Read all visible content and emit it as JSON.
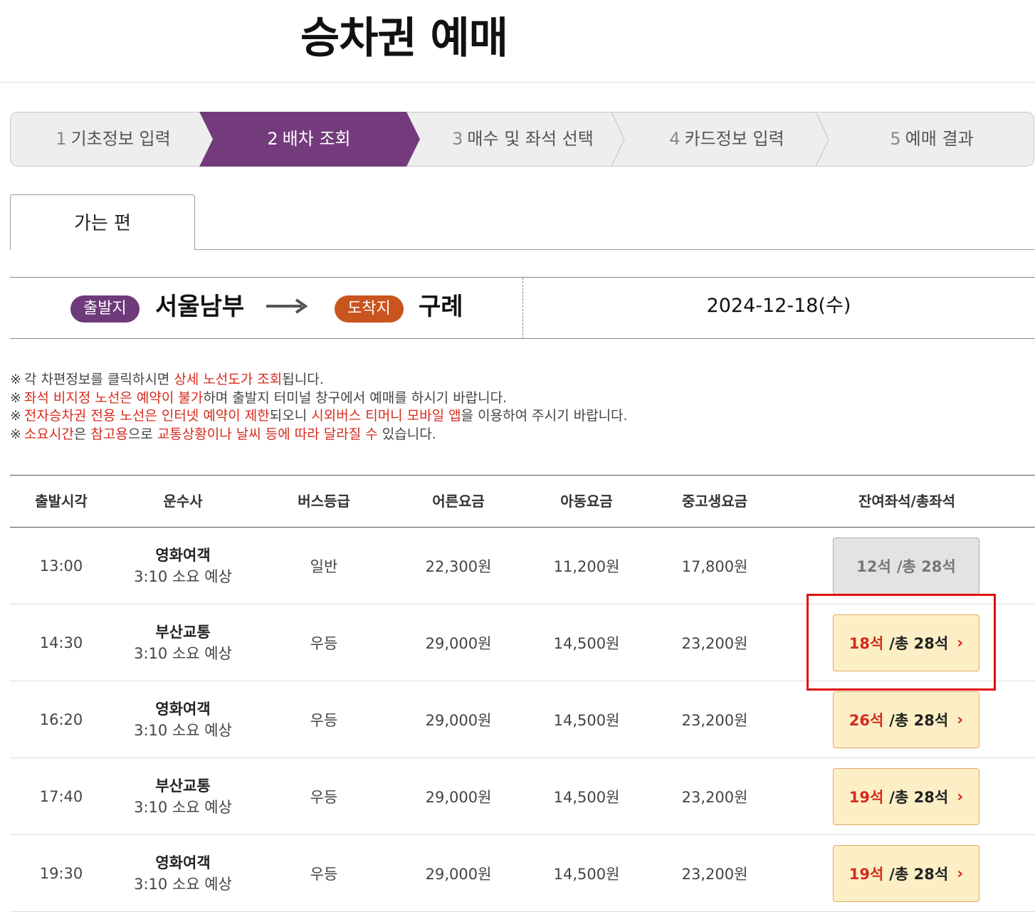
{
  "title": "승차권 예매",
  "steps": [
    {
      "num": "1",
      "label": "기초정보 입력"
    },
    {
      "num": "2",
      "label": "배차 조회"
    },
    {
      "num": "3",
      "label": "매수 및 좌석 선택"
    },
    {
      "num": "4",
      "label": "카드정보 입력"
    },
    {
      "num": "5",
      "label": "예매 결과"
    }
  ],
  "active_step": 2,
  "tab": {
    "label": "가는 편"
  },
  "route": {
    "departure_badge": "출발지",
    "departure": "서울남부",
    "arrival_badge": "도착지",
    "arrival": "구례",
    "date": "2024-12-18(수)"
  },
  "notices": [
    {
      "mark": "※",
      "parts": [
        {
          "t": "각 차편정보를 클릭하시면 "
        },
        {
          "t": "상세 노선도가 조회",
          "hl": true
        },
        {
          "t": "됩니다."
        }
      ]
    },
    {
      "mark": "※",
      "parts": [
        {
          "t": "좌석 비지정 노선은 예약이 불가",
          "hl": true
        },
        {
          "t": "하며 출발지 터미널 창구에서 예매를 하시기 바랍니다."
        }
      ]
    },
    {
      "mark": "※",
      "parts": [
        {
          "t": "전자승차권 전용 노선은 인터넷 예약이 제한",
          "hl": true
        },
        {
          "t": "되오니 "
        },
        {
          "t": "시외버스 티머니 모바일 앱",
          "hl": true
        },
        {
          "t": "을 이용하여 주시기 바랍니다."
        }
      ]
    },
    {
      "mark": "※",
      "parts": [
        {
          "t": "소요시간",
          "hl": true
        },
        {
          "t": "은 "
        },
        {
          "t": "참고용",
          "hl": true
        },
        {
          "t": "으로 "
        },
        {
          "t": "교통상황이나 날씨 등에 따라 달라질 수",
          "hl": true
        },
        {
          "t": " 있습니다."
        }
      ]
    }
  ],
  "table": {
    "headers": [
      "출발시각",
      "운수사",
      "버스등급",
      "어른요금",
      "아동요금",
      "중고생요금",
      "잔여좌석/총좌석"
    ],
    "rows": [
      {
        "time": "13:00",
        "company": "영화여객",
        "duration": "3:10 소요 예상",
        "grade": "일반",
        "adult": "22,300원",
        "child": "11,200원",
        "student": "17,800원",
        "remain": "12석",
        "total": "/총 28석",
        "available": false
      },
      {
        "time": "14:30",
        "company": "부산교통",
        "duration": "3:10 소요 예상",
        "grade": "우등",
        "adult": "29,000원",
        "child": "14,500원",
        "student": "23,200원",
        "remain": "18석",
        "total": "/총 28석",
        "available": true
      },
      {
        "time": "16:20",
        "company": "영화여객",
        "duration": "3:10 소요 예상",
        "grade": "우등",
        "adult": "29,000원",
        "child": "14,500원",
        "student": "23,200원",
        "remain": "26석",
        "total": "/총 28석",
        "available": true
      },
      {
        "time": "17:40",
        "company": "부산교통",
        "duration": "3:10 소요 예상",
        "grade": "우등",
        "adult": "29,000원",
        "child": "14,500원",
        "student": "23,200원",
        "remain": "19석",
        "total": "/총 28석",
        "available": true
      },
      {
        "time": "19:30",
        "company": "영화여객",
        "duration": "3:10 소요 예상",
        "grade": "우등",
        "adult": "29,000원",
        "child": "14,500원",
        "student": "23,200원",
        "remain": "19석",
        "total": "/총 28석",
        "available": true
      }
    ]
  },
  "colors": {
    "active_step": "#733b7c",
    "departure_badge": "#6e3a7a",
    "arrival_badge": "#c9541e",
    "highlight_text": "#d62b1e",
    "annotation_box": "#e01010"
  },
  "icons": [
    "arrow-right-icon",
    "chevron-right-icon"
  ]
}
